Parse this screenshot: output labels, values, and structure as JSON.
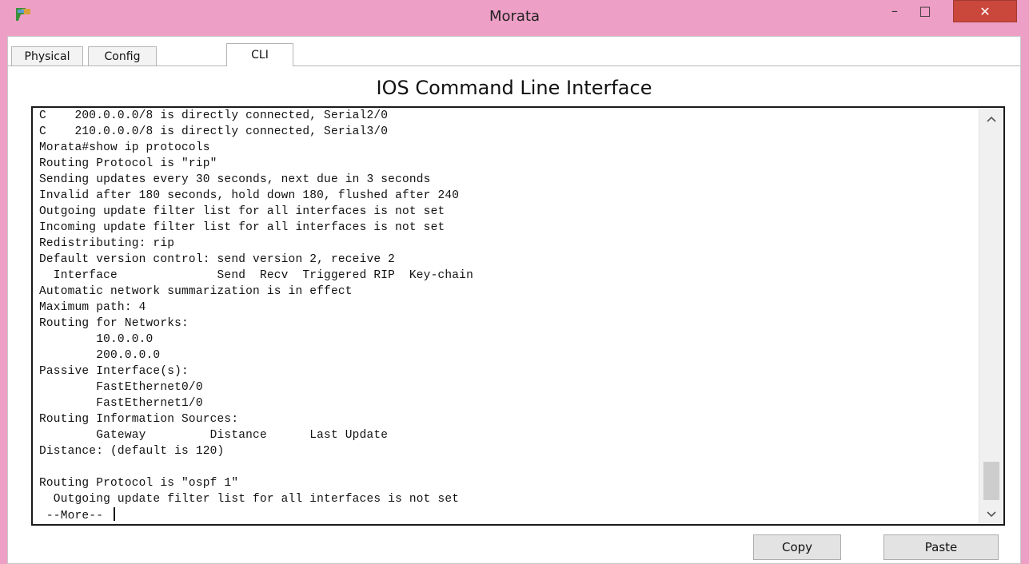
{
  "window": {
    "title": "Morata",
    "minimize_glyph": "–",
    "maximize_glyph": "□",
    "close_glyph": "✕"
  },
  "tabs": [
    {
      "label": "Physical",
      "active": false
    },
    {
      "label": "Config",
      "active": false
    },
    {
      "label": "CLI",
      "active": true
    }
  ],
  "cli": {
    "heading": "IOS Command Line Interface",
    "lines": [
      "C    200.0.0.0/8 is directly connected, Serial2/0",
      "C    210.0.0.0/8 is directly connected, Serial3/0",
      "Morata#show ip protocols",
      "Routing Protocol is \"rip\"",
      "Sending updates every 30 seconds, next due in 3 seconds",
      "Invalid after 180 seconds, hold down 180, flushed after 240",
      "Outgoing update filter list for all interfaces is not set",
      "Incoming update filter list for all interfaces is not set",
      "Redistributing: rip",
      "Default version control: send version 2, receive 2",
      "  Interface              Send  Recv  Triggered RIP  Key-chain",
      "Automatic network summarization is in effect",
      "Maximum path: 4",
      "Routing for Networks:",
      "        10.0.0.0",
      "        200.0.0.0",
      "Passive Interface(s):",
      "        FastEthernet0/0",
      "        FastEthernet1/0",
      "Routing Information Sources:",
      "        Gateway         Distance      Last Update",
      "Distance: (default is 120)",
      "",
      "Routing Protocol is \"ospf 1\"",
      "  Outgoing update filter list for all interfaces is not set",
      " --More-- "
    ]
  },
  "buttons": {
    "copy": "Copy",
    "paste": "Paste"
  },
  "colors": {
    "titlebar": "#ee9fc6",
    "close_button": "#c9473b"
  }
}
